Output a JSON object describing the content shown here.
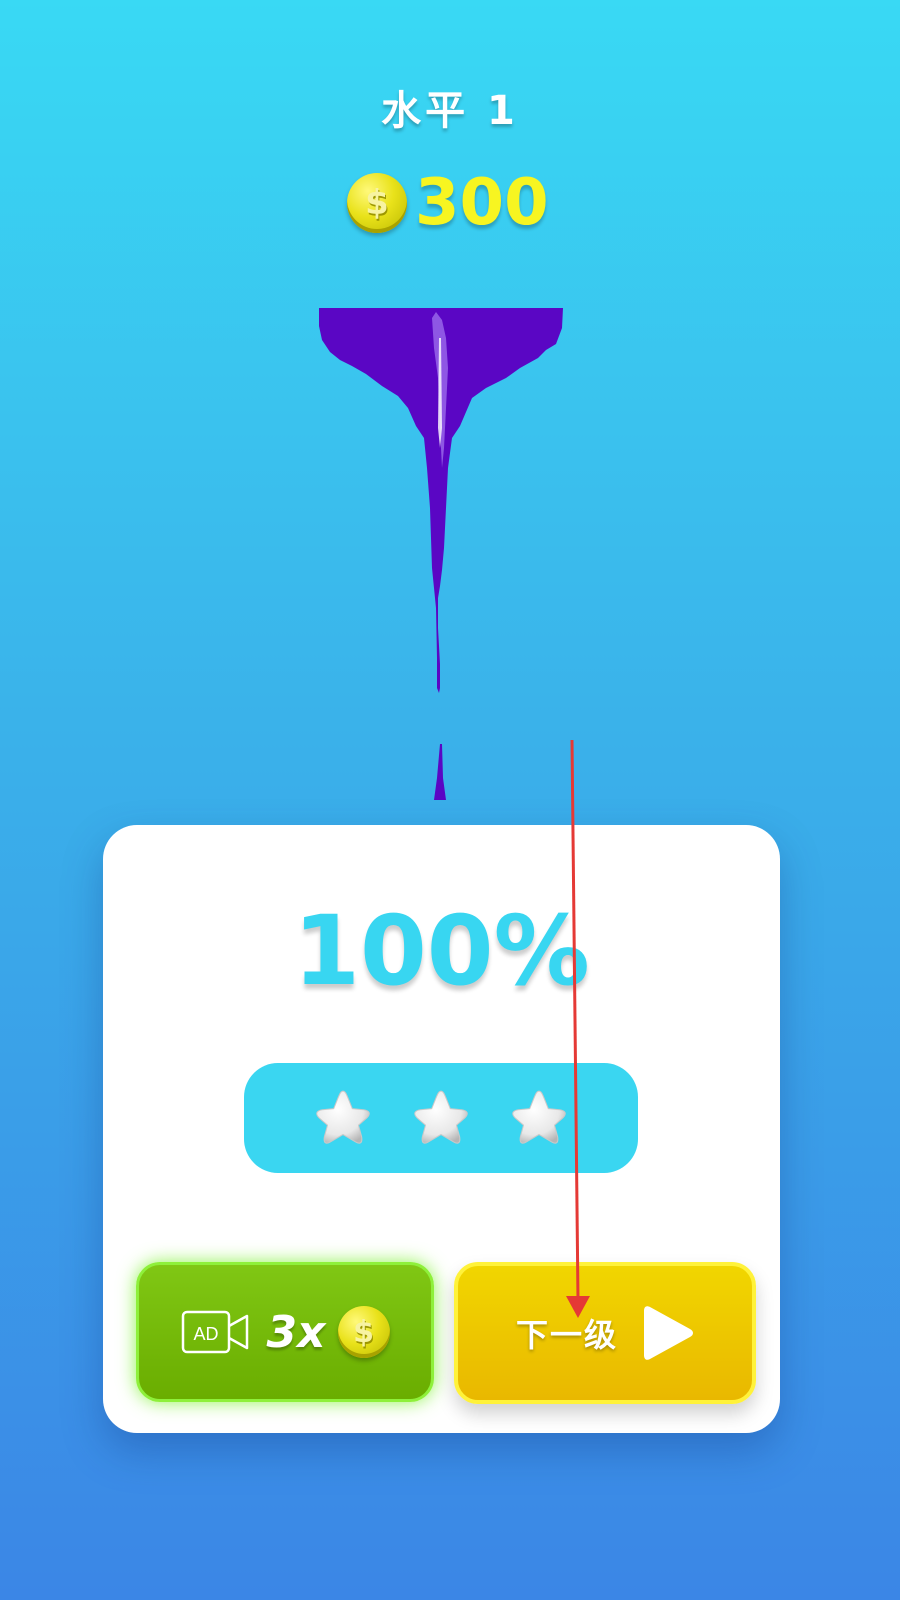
{
  "level": {
    "title": "水平 1"
  },
  "currency": {
    "icon": "dollar-coin-icon",
    "symbol": "$",
    "amount": "300"
  },
  "result": {
    "percent": "100%",
    "stars_earned": 3,
    "stars_total": 3
  },
  "buttons": {
    "ad": {
      "ad_text": "AD",
      "multiplier": "3x",
      "coin_symbol": "$"
    },
    "next": {
      "label": "下一级"
    }
  },
  "colors": {
    "paint": "#5a06c4",
    "accent_cyan": "#38d6f1",
    "coin_yellow": "#f7f521",
    "ad_green": "#6aad00",
    "next_yellow": "#f1d600",
    "annotation_arrow": "#e53935"
  }
}
